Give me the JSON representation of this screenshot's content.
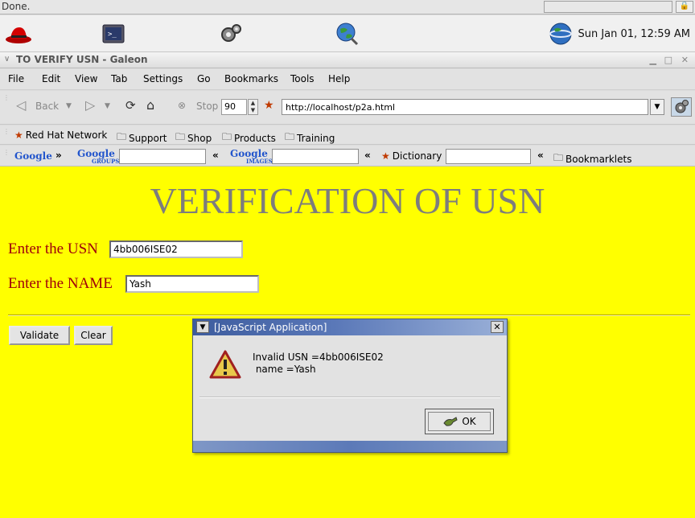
{
  "status": {
    "text": "Done."
  },
  "panel": {
    "clock": "Sun Jan 01, 12:59 AM"
  },
  "window": {
    "title": "TO VERIFY USN - Galeon"
  },
  "menu": {
    "items": [
      "File",
      "Edit",
      "View",
      "Tab",
      "Settings",
      "Go",
      "Bookmarks",
      "Tools",
      "Help"
    ]
  },
  "nav": {
    "back_label": "Back",
    "stop_label": "Stop",
    "stop_value": "90",
    "url": "http://localhost/p2a.html"
  },
  "bookmarks": {
    "items": [
      "Red Hat Network",
      "Support",
      "Shop",
      "Products",
      "Training"
    ]
  },
  "google_bar": {
    "google": "Google",
    "groups": "Google",
    "groups_sub": "GROUPS",
    "images": "Google",
    "images_sub": "IMAGES",
    "dictionary": "Dictionary",
    "bookmarklets": "Bookmarklets"
  },
  "page": {
    "heading": "VERIFICATION OF USN",
    "usn_label": "Enter the USN",
    "usn_value": "4bb006ISE02",
    "name_label": "Enter the NAME",
    "name_value": "Yash",
    "validate_label": "Validate",
    "clear_label": "Clear"
  },
  "dialog": {
    "title": "[JavaScript Application]",
    "message": "Invalid USN =4bb006ISE02\n name =Yash",
    "ok_label": "OK"
  },
  "colors": {
    "page_bg": "#ffff00",
    "heading": "#7d7d7d",
    "label": "#a0000a",
    "dialog_title": "#3d5c9e"
  }
}
